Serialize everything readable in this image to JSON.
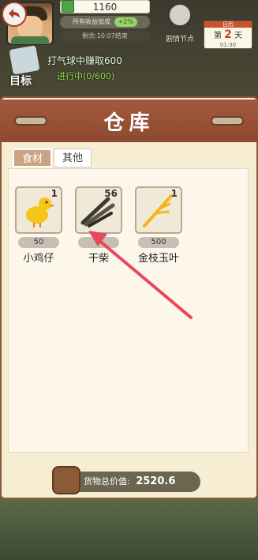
{
  "hud": {
    "coins": "1160",
    "income_label": "所有收益加成",
    "income_pct": "+2%",
    "remaining": "剩余:10:07结束",
    "story_node": "剧情节点",
    "calendar_head": "日历",
    "day_prefix": "第",
    "day_num": "2",
    "day_suffix": "天",
    "time": "01:30",
    "goal_label": "目标",
    "goal_task": "打气球中赚取600",
    "goal_progress": "进行中(0/600)"
  },
  "panel": {
    "title": "仓库",
    "tabs": [
      {
        "label": "食材",
        "active": true
      },
      {
        "label": "其他",
        "active": false
      }
    ],
    "items": [
      {
        "name": "小鸡仔",
        "count": "1",
        "price": "50",
        "icon": "chick-icon"
      },
      {
        "name": "干柴",
        "count": "56",
        "price": "",
        "icon": "firewood-icon"
      },
      {
        "name": "金枝玉叶",
        "count": "1",
        "price": "500",
        "icon": "golden-branch-icon"
      }
    ],
    "total_label": "货物总价值:",
    "total_value": "2520.6"
  },
  "colors": {
    "accent": "#a4593d",
    "panel_bg": "#f6edd3",
    "arrow": "#e8475c"
  }
}
